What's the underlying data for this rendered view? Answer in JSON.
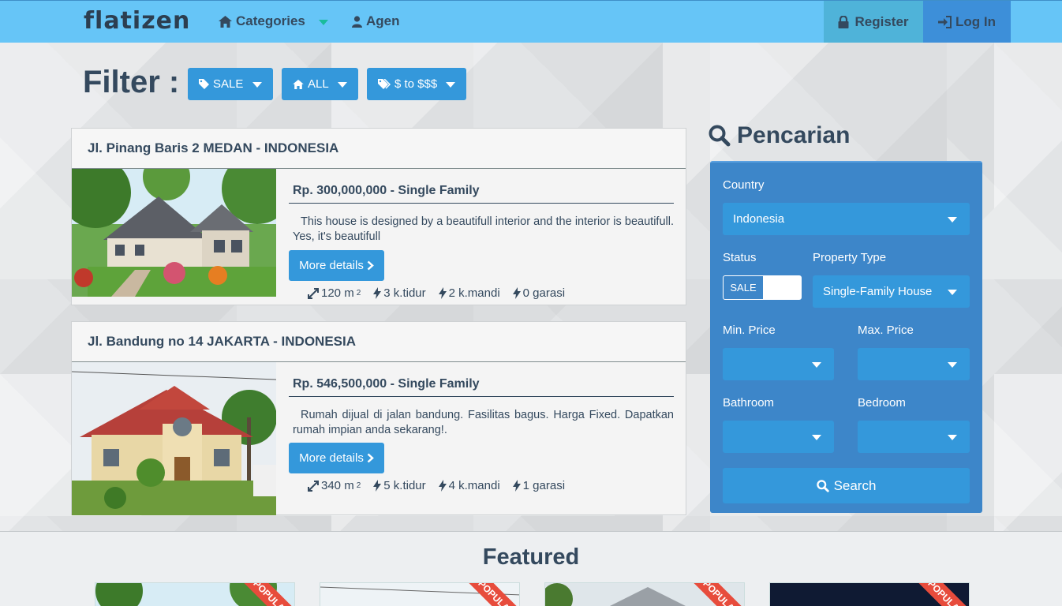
{
  "navbar": {
    "logo": "flatizen",
    "categories": "Categories",
    "agen": "Agen",
    "register": "Register",
    "login": "Log In"
  },
  "filter": {
    "title": "Filter :",
    "sale": "SALE",
    "all": "ALL",
    "price": "$ to $$$"
  },
  "listings": [
    {
      "title": "Jl. Pinang Baris 2 MEDAN - INDONESIA",
      "price": "Rp. 300,000,000 - Single Family",
      "description": "This house is designed by a beautifull interior and the interior is beautifull. Yes, it's beautifull",
      "button": "More details",
      "area": "120 m",
      "area_sup": "2",
      "bedrooms": "3 k.tidur",
      "bathrooms": "2 k.mandi",
      "garage": "0 garasi"
    },
    {
      "title": "Jl. Bandung no 14 JAKARTA - INDONESIA",
      "price": "Rp. 546,500,000 - Single Family",
      "description": "Rumah dijual di jalan bandung. Fasilitas bagus. Harga Fixed. Dapatkan rumah impian anda sekarang!.",
      "button": "More details",
      "area": "340 m",
      "area_sup": "2",
      "bedrooms": "5 k.tidur",
      "bathrooms": "4 k.mandi",
      "garage": "1 garasi"
    }
  ],
  "search": {
    "heading": "Pencarian",
    "country_label": "Country",
    "country_value": "Indonesia",
    "status_label": "Status",
    "status_value": "SALE",
    "type_label": "Property Type",
    "type_value": "Single-Family House",
    "min_price_label": "Min. Price",
    "max_price_label": "Max. Price",
    "bathroom_label": "Bathroom",
    "bedroom_label": "Bedroom",
    "button": "Search"
  },
  "featured": {
    "title": "Featured",
    "ribbon": "POPULAR"
  },
  "colors": {
    "navbar": "#66c5f7",
    "primary": "#3498db",
    "panel": "#3d86c9",
    "text": "#34495e",
    "ribbon": "#e74c3c"
  }
}
